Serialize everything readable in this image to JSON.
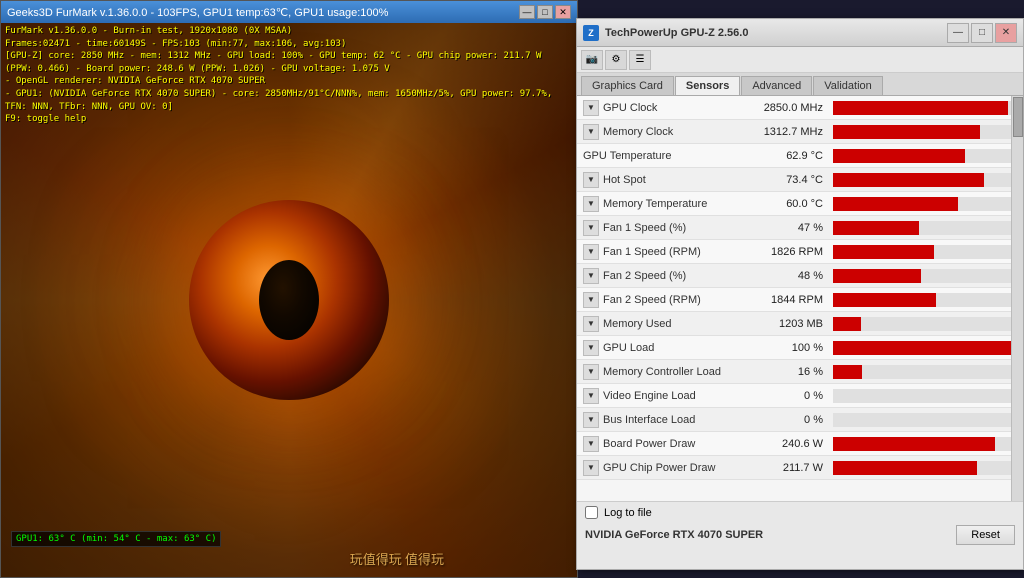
{
  "furmark": {
    "title": "Geeks3D FurMark v.1.36.0.0 - 103FPS, GPU1 temp:63℃, GPU1 usage:100%",
    "info_line1": "FurMark v1.36.0.0 - Burn-in test, 1920x1080 (0X MSAA)",
    "info_line2": "Frames:02471 - time:60149S - FPS:103 (min:77, max:106, avg:103)",
    "info_line3": "[GPU-Z] core: 2850 MHz - mem: 1312 MHz - GPU load: 100% - GPU temp: 62 °C - GPU chip power: 211.7 W (PPW: 0.466) - Board power: 248.6 W (PPW: 1.026) - GPU voltage: 1.075 V",
    "info_line4": "- OpenGL renderer: NVIDIA GeForce RTX 4070 SUPER",
    "info_line5": "- GPU1: (NVIDIA GeForce RTX 4070 SUPER) - core: 2850MHz/91°C/NNN%, mem: 1650MHz/5%, GPU power: 97.7%, TFN: NNN, TFbr: NNN, GPU OV: 0]",
    "info_line6": "F9: toggle help",
    "bottom_info": "GPU1: 63° C (min: 54° C - max: 63° C)",
    "window_buttons": {
      "minimize": "—",
      "maximize": "□",
      "close": "✕"
    }
  },
  "gpuz": {
    "title": "TechPowerUp GPU-Z 2.56.0",
    "window_buttons": {
      "minimize": "—",
      "maximize": "□",
      "close": "✕"
    },
    "toolbar": {
      "icons": [
        "📷",
        "⚙",
        "☰"
      ]
    },
    "tabs": [
      {
        "label": "Graphics Card",
        "active": false
      },
      {
        "label": "Sensors",
        "active": true
      },
      {
        "label": "Advanced",
        "active": false
      },
      {
        "label": "Validation",
        "active": false
      }
    ],
    "sensors": [
      {
        "label": "GPU Clock",
        "value": "2850.0 MHz",
        "bar_pct": 95,
        "has_dropdown": true
      },
      {
        "label": "Memory Clock",
        "value": "1312.7 MHz",
        "bar_pct": 80,
        "has_dropdown": true
      },
      {
        "label": "GPU Temperature",
        "value": "62.9 °C",
        "bar_pct": 72,
        "has_dropdown": false
      },
      {
        "label": "Hot Spot",
        "value": "73.4 °C",
        "bar_pct": 82,
        "has_dropdown": true
      },
      {
        "label": "Memory Temperature",
        "value": "60.0 °C",
        "bar_pct": 68,
        "has_dropdown": true
      },
      {
        "label": "Fan 1 Speed (%)",
        "value": "47 %",
        "bar_pct": 47,
        "has_dropdown": true
      },
      {
        "label": "Fan 1 Speed (RPM)",
        "value": "1826 RPM",
        "bar_pct": 55,
        "has_dropdown": true
      },
      {
        "label": "Fan 2 Speed (%)",
        "value": "48 %",
        "bar_pct": 48,
        "has_dropdown": true
      },
      {
        "label": "Fan 2 Speed (RPM)",
        "value": "1844 RPM",
        "bar_pct": 56,
        "has_dropdown": true
      },
      {
        "label": "Memory Used",
        "value": "1203 MB",
        "bar_pct": 15,
        "has_dropdown": true
      },
      {
        "label": "GPU Load",
        "value": "100 %",
        "bar_pct": 100,
        "has_dropdown": true
      },
      {
        "label": "Memory Controller Load",
        "value": "16 %",
        "bar_pct": 16,
        "has_dropdown": true
      },
      {
        "label": "Video Engine Load",
        "value": "0 %",
        "bar_pct": 0,
        "has_dropdown": true
      },
      {
        "label": "Bus Interface Load",
        "value": "0 %",
        "bar_pct": 0,
        "has_dropdown": true
      },
      {
        "label": "Board Power Draw",
        "value": "240.6 W",
        "bar_pct": 88,
        "has_dropdown": true
      },
      {
        "label": "GPU Chip Power Draw",
        "value": "211.7 W",
        "bar_pct": 78,
        "has_dropdown": true
      }
    ],
    "log_to_file": "Log to file",
    "reset_button": "Reset",
    "gpu_name": "NVIDIA GeForce RTX 4070 SUPER",
    "watermark": "玩值得玩值得玩"
  }
}
